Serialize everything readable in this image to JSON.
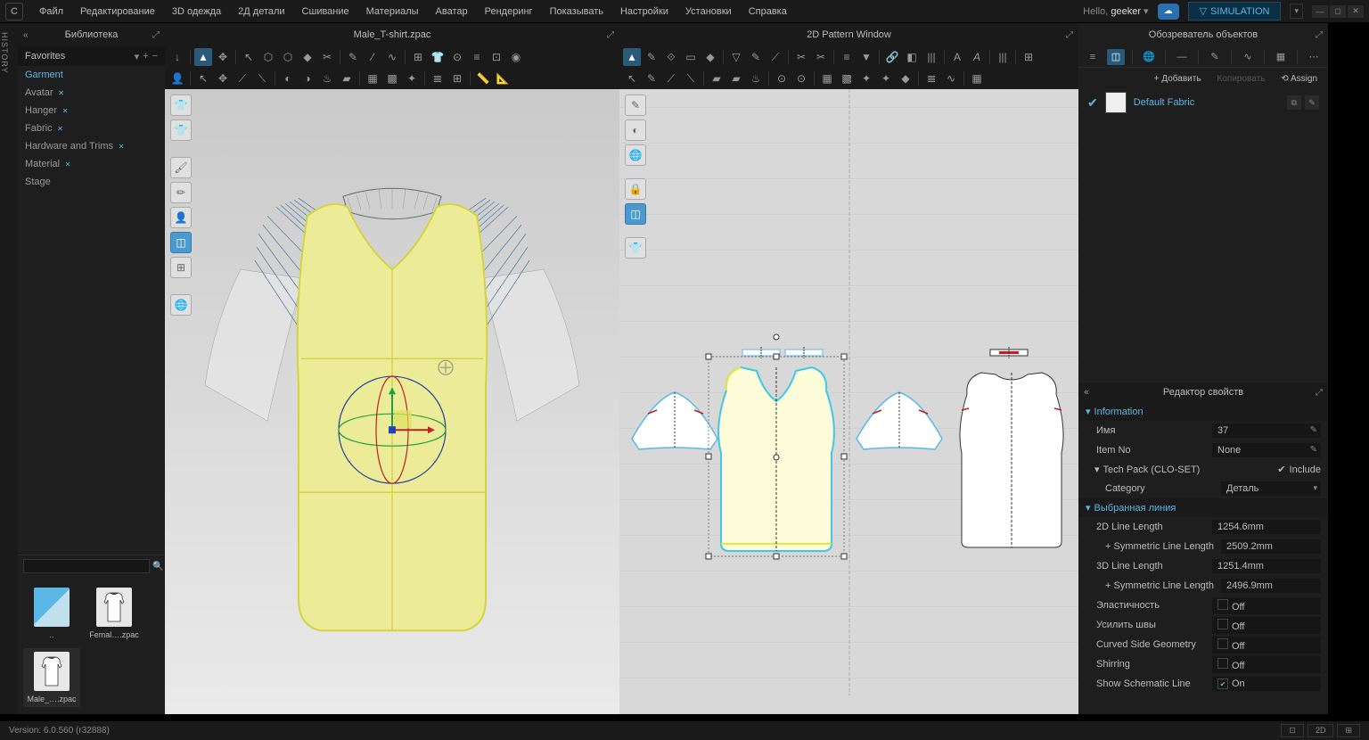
{
  "menu": {
    "items": [
      "Файл",
      "Редактирование",
      "3D одежда",
      "2Д детали",
      "Сшивание",
      "Материалы",
      "Аватар",
      "Рендеринг",
      "Показывать",
      "Настройки",
      "Установки",
      "Справка"
    ]
  },
  "top": {
    "hello_prefix": "Hello, ",
    "user": "geeker",
    "sim": "SIMULATION"
  },
  "library": {
    "title": "Библиотека",
    "favorites": "Favorites",
    "items": [
      {
        "label": "Garment",
        "sel": true
      },
      {
        "label": "Avatar"
      },
      {
        "label": "Hanger"
      },
      {
        "label": "Fabric"
      },
      {
        "label": "Hardware and Trims"
      },
      {
        "label": "Material"
      },
      {
        "label": "Stage"
      }
    ],
    "thumbs": [
      {
        "label": ".."
      },
      {
        "label": "Femal….zpac"
      },
      {
        "label": "Male_….zpac",
        "sel": true
      }
    ]
  },
  "view3d": {
    "title": "Male_T-shirt.zpac"
  },
  "view2d": {
    "title": "2D Pattern Window"
  },
  "objects": {
    "title": "Обозреватель объектов",
    "add": "+ Добавить",
    "copy": "Копировать",
    "assign": "Assign",
    "fabric": "Default Fabric"
  },
  "properties": {
    "title": "Редактор свойств",
    "groups": {
      "info": {
        "label": "Information",
        "rows": {
          "name": {
            "k": "Имя",
            "v": "37"
          },
          "item": {
            "k": "Item No",
            "v": "None"
          }
        }
      },
      "techpack": {
        "label": "Tech Pack (CLO-SET)",
        "include_label": "Include",
        "include": true,
        "category_label": "Category",
        "category_value": "Деталь"
      },
      "selline": {
        "label": "Выбранная линия",
        "rows": [
          {
            "k": "2D Line Length",
            "v": "1254.6mm"
          },
          {
            "k": "+ Symmetric Line Length",
            "v": "2509.2mm",
            "sub": true
          },
          {
            "k": "3D Line Length",
            "v": "1251.4mm"
          },
          {
            "k": "+ Symmetric Line Length",
            "v": "2496.9mm",
            "sub": true
          },
          {
            "k": "Эластичность",
            "v": "Off",
            "cb": true
          },
          {
            "k": "Усилить швы",
            "v": "Off",
            "cb": true
          },
          {
            "k": "Curved Side Geometry",
            "v": "Off",
            "cb": true
          },
          {
            "k": "Shirring",
            "v": "Off",
            "cb": true
          },
          {
            "k": "Show Schematic Line",
            "v": "On",
            "cb": true,
            "checked": true
          }
        ]
      }
    }
  },
  "status": {
    "version": "Version: 6.0.560 (r32888)"
  }
}
